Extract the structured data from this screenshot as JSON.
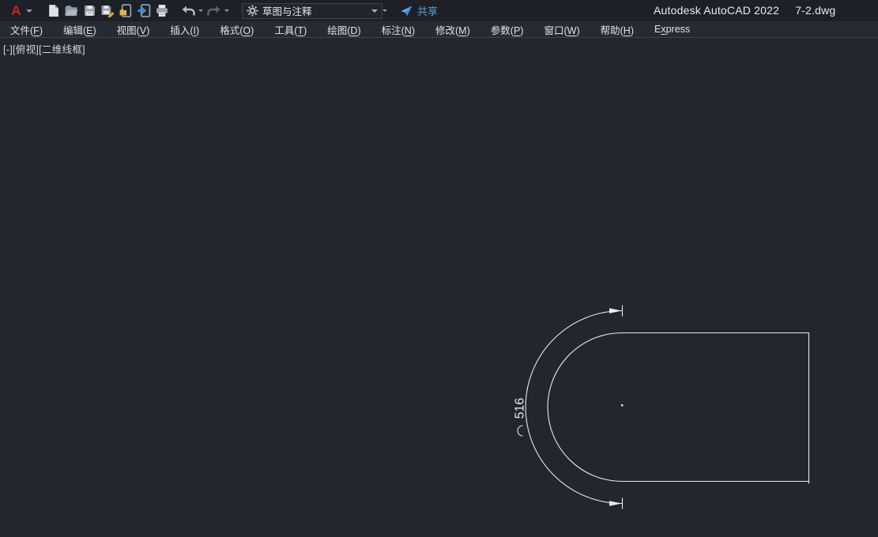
{
  "window": {
    "product": "Autodesk AutoCAD 2022",
    "document": "7-2.dwg"
  },
  "quick_access_toolbar": {
    "workspace_selector": {
      "value": "草图与注释",
      "icon": "gear-icon"
    },
    "share_label": "共享",
    "icons": [
      "autocad-logo-menu",
      "new-file",
      "open-file",
      "save",
      "save-as",
      "open-from-web-mobile",
      "save-to-web-mobile",
      "plot",
      "undo",
      "redo",
      "workspace-gear",
      "share-plane"
    ]
  },
  "menu_bar": {
    "items": [
      {
        "name": "file",
        "pre": "文件(",
        "key": "F",
        "post": ")"
      },
      {
        "name": "edit",
        "pre": "编辑(",
        "key": "E",
        "post": ")"
      },
      {
        "name": "view",
        "pre": "视图(",
        "key": "V",
        "post": ")"
      },
      {
        "name": "insert",
        "pre": "插入(",
        "key": "I",
        "post": ")"
      },
      {
        "name": "format",
        "pre": "格式(",
        "key": "O",
        "post": ")"
      },
      {
        "name": "tools",
        "pre": "工具(",
        "key": "T",
        "post": ")"
      },
      {
        "name": "draw",
        "pre": "绘图(",
        "key": "D",
        "post": ")"
      },
      {
        "name": "dimension",
        "pre": "标注(",
        "key": "N",
        "post": ")"
      },
      {
        "name": "modify",
        "pre": "修改(",
        "key": "M",
        "post": ")"
      },
      {
        "name": "parametric",
        "pre": "参数(",
        "key": "P",
        "post": ")"
      },
      {
        "name": "window",
        "pre": "窗口(",
        "key": "W",
        "post": ")"
      },
      {
        "name": "help",
        "pre": "帮助(",
        "key": "H",
        "post": ")"
      },
      {
        "name": "express",
        "pre": "E",
        "key": "x",
        "post": "press"
      }
    ]
  },
  "viewport": {
    "controls_label": "[-][俯视][二维线框]"
  },
  "drawing": {
    "entities": [
      {
        "type": "closed-polyline",
        "description": "rectangle with semicircular left end (180-degree arc closing the open left side)"
      },
      {
        "type": "point",
        "description": "center point of the semicircular arc"
      }
    ],
    "dimension": {
      "type": "arc-length",
      "symbol": "⌒",
      "value": "516",
      "text_rotation": "90deg-ccw"
    }
  },
  "colors": {
    "titlebar_bg": "#1d2127",
    "menubar_bg": "#262a33",
    "canvas_bg": "#22262e",
    "line": "#e8ebee",
    "logo_red": "#c5281c",
    "share_blue": "#5c9fd6",
    "accent_blue": "#3f8edb",
    "pencil_yellow": "#dfa93c"
  }
}
